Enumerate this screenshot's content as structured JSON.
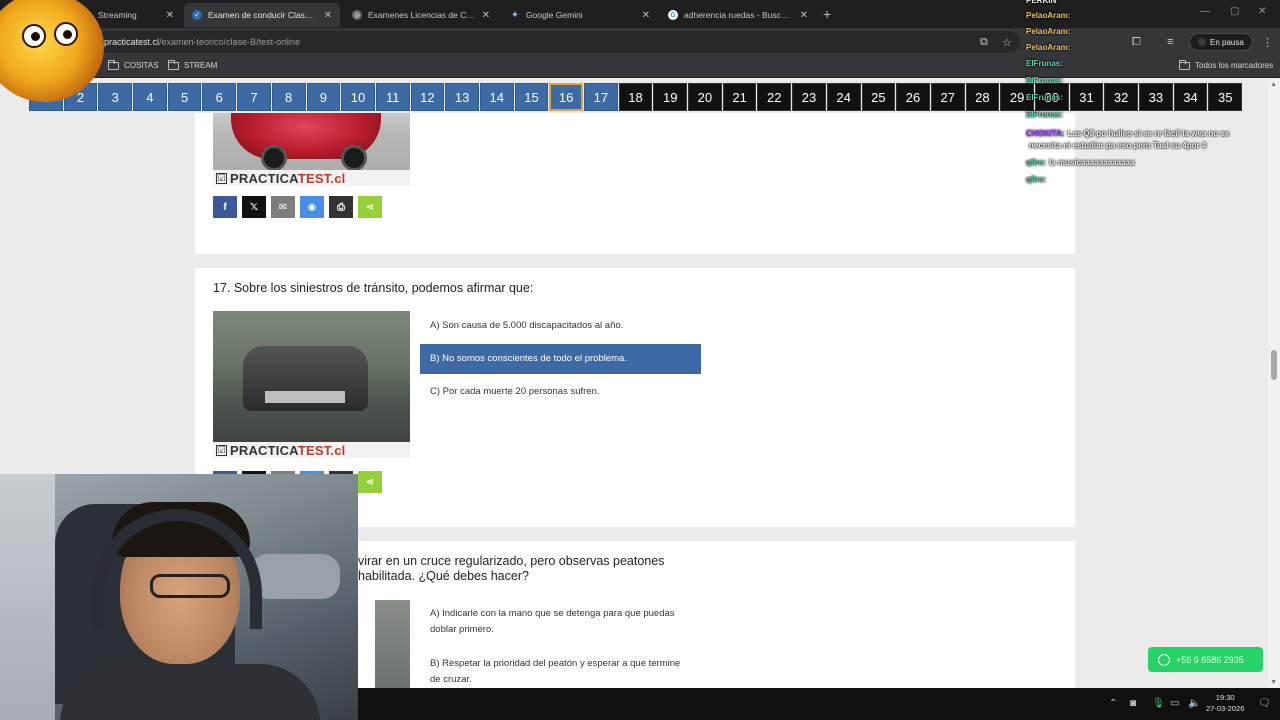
{
  "browser": {
    "tabs": [
      {
        "title": "Streaming",
        "active": false,
        "favicon_color": "#e04b2b"
      },
      {
        "title": "Examen de conducir Clase B - C",
        "active": true,
        "favicon_color": "#2b6cb0"
      },
      {
        "title": "Examenes Licencias de Conduc",
        "active": false,
        "favicon_color": "#666666"
      },
      {
        "title": "Google Gemini",
        "active": false,
        "favicon_color": "#4a90d9"
      },
      {
        "title": "adherencia ruedas - Buscar con",
        "active": false,
        "favicon_color": "#4285f4"
      }
    ],
    "url_domain": "practicatest.cl",
    "url_path": "/examen-teorico/clase-B/test-online",
    "paused_label": "En pausa",
    "bookmarks": [
      "COSITAS",
      "STREAM"
    ],
    "all_bookmarks_label": "Todos los marcadores"
  },
  "question_nav": {
    "numbers": [
      "1",
      "2",
      "3",
      "4",
      "5",
      "6",
      "7",
      "8",
      "9",
      "10",
      "11",
      "12",
      "13",
      "14",
      "15",
      "16",
      "17",
      "18",
      "19",
      "20",
      "21",
      "22",
      "23",
      "24",
      "25",
      "26",
      "27",
      "28",
      "29",
      "30",
      "31",
      "32",
      "33",
      "34",
      "35"
    ],
    "current": "16",
    "answered_through": 17
  },
  "branding": {
    "check": "☑",
    "brand_left": "PRACTICA",
    "brand_right": "TEST.cl"
  },
  "share_buttons": [
    {
      "name": "facebook",
      "glyph": "f",
      "color": "#3b5998"
    },
    {
      "name": "x",
      "glyph": "𝕏",
      "color": "#111111"
    },
    {
      "name": "email",
      "glyph": "✉",
      "color": "#7d7d7d"
    },
    {
      "name": "messenger",
      "glyph": "◉",
      "color": "#4a90e2"
    },
    {
      "name": "print",
      "glyph": "⎙",
      "color": "#333333"
    },
    {
      "name": "sharethis",
      "glyph": "⋖",
      "color": "#95d03a"
    }
  ],
  "question_17": {
    "title": "17. Sobre los siniestros de tránsito, podemos afirmar que:",
    "options": [
      {
        "text": "A) Son causa de 5.000 discapacitados al año.",
        "selected": false
      },
      {
        "text": "B) No somos conscientes de todo el problema.",
        "selected": true
      },
      {
        "text": "C) Por cada muerte 20 personas sufren.",
        "selected": false
      }
    ]
  },
  "question_18": {
    "title_line1": "virar en un cruce regularizado, pero observas peatones",
    "title_line2": "habilitada. ¿Qué debes hacer?",
    "options": [
      {
        "text": "A) Indicarle con la mano que se detenga para que puedas doblar primero."
      },
      {
        "text": "B) Respetar la prioridad del peatón y esperar a que termine de cruzar."
      }
    ]
  },
  "whatsapp": {
    "label": "+56 9 6586 2935"
  },
  "taskbar": {
    "time": "19:30",
    "date": "27-03-2026"
  },
  "chat": {
    "header": "PERKIN",
    "lines": [
      {
        "user": "PelaoAram:",
        "msg": "",
        "color": "y"
      },
      {
        "user": "PelaoAram:",
        "msg": "",
        "color": "y"
      },
      {
        "user": "PelaoAram:",
        "msg": "",
        "color": "y"
      },
      {
        "user": "ElFrunas:",
        "msg": "",
        "color": "g"
      },
      {
        "user": "ElFrunas:",
        "msg": "",
        "color": "g"
      },
      {
        "user": "ElFrunas:",
        "msg": "",
        "color": "g"
      },
      {
        "user": "ElFrunas:",
        "msg": "",
        "color": "g"
      },
      {
        "user": "CHOKITA:",
        "msg": "Las Q8 po hulleo si se re fácil la wea no se",
        "color": "p"
      },
      {
        "user": "",
        "msg": "necesita ni estudiar pa eso pero Taal su 4por 4",
        "color": "p"
      },
      {
        "user": "qfire:",
        "msg": "la musicaaaaaaaaaaaa",
        "color": "g"
      },
      {
        "user": "qfire:",
        "msg": "",
        "color": "g"
      }
    ]
  }
}
